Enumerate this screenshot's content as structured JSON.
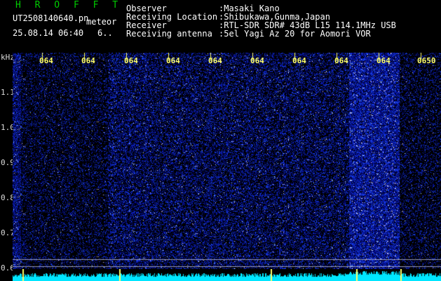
{
  "header": {
    "logo": "H R O F F T",
    "filename": "UT2508140640.pn",
    "type_label": "meteor",
    "date_time": "25.08.14 06:40",
    "count": "6..",
    "fields": [
      {
        "label": "Observer",
        "value": ":Masaki Kano"
      },
      {
        "label": "Receiving Location",
        "value": ":Shibukawa,Gunma,Japan"
      },
      {
        "label": "Receiver",
        "value": ":RTL-SDR SDR# 43dB L15 114.1MHz USB"
      },
      {
        "label": "Receiving antenna",
        "value": ":5el Yagi Az 20 for Aomori VOR"
      }
    ]
  },
  "spectrogram": {
    "y_unit": "kHz",
    "y_ticks": [
      "1.1",
      "1.0",
      "0.9",
      "0.8",
      "0.7",
      "0.6"
    ],
    "time_ticks": [
      "064",
      "064",
      "064",
      "064",
      "064",
      "064",
      "064",
      "064",
      "064",
      "0650"
    ]
  },
  "colors": {
    "logo": "#00cc00",
    "time_labels": "#ffff66",
    "noise": "#1a3aff",
    "baseline": "#00e6ff"
  }
}
